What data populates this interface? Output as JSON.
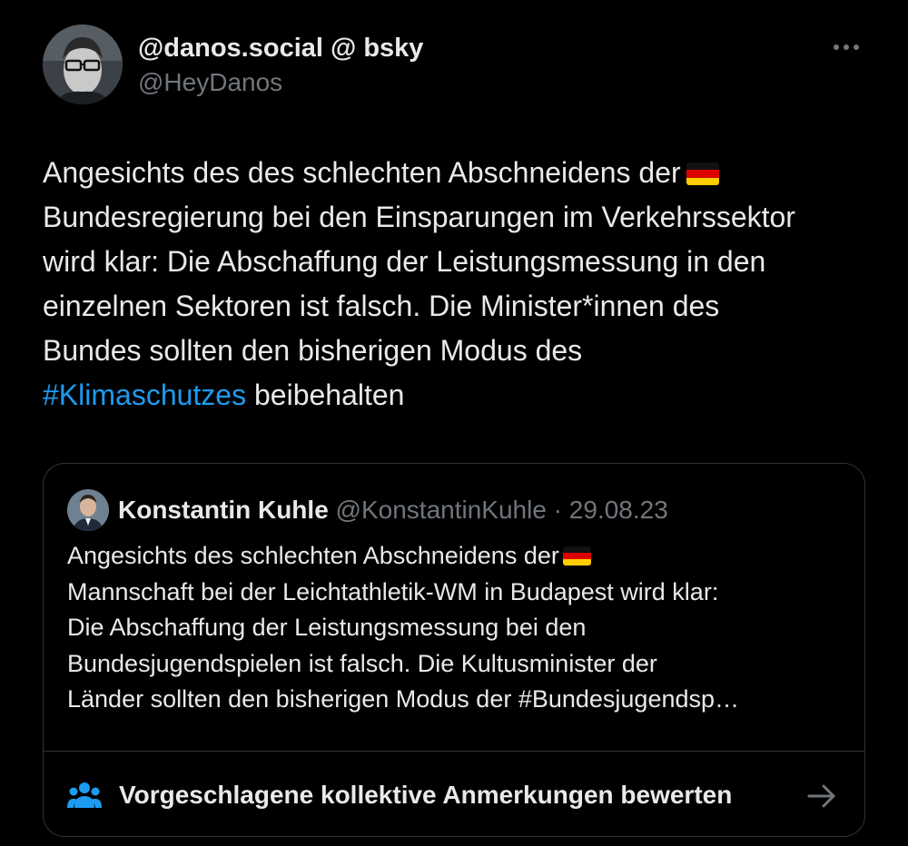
{
  "tweet": {
    "author": {
      "display_name": "@danos.social @ bsky",
      "handle": "@HeyDanos"
    },
    "more_icon": "more-horizontal-icon",
    "body": {
      "line1": "Angesichts des des schlechten Abschneidens der",
      "line2": "Bundesregierung bei den Einsparungen im Verkehrssektor",
      "line3": "wird klar: Die Abschaffung der Leistungsmessung in den",
      "line4": "einzelnen Sektoren ist falsch. Die Minister*innen des",
      "line5": "Bundes sollten den bisherigen Modus des",
      "hashtag": "#Klimaschutzes",
      "line6_rest": " beibehalten",
      "flag_emoji": "germany-flag-icon"
    },
    "quote": {
      "author": {
        "display_name": "Konstantin Kuhle",
        "handle": "@KonstantinKuhle",
        "separator": " · ",
        "date": "29.08.23"
      },
      "text": {
        "line1": "Angesichts des schlechten Abschneidens der",
        "line2": "Mannschaft bei der Leichtathletik-WM in Budapest wird klar:",
        "line3": "Die Abschaffung der Leistungsmessung bei den",
        "line4": "Bundesjugendspielen ist falsch. Die Kultusminister der",
        "line5": "Länder sollten den bisherigen Modus der #Bundesjugendsp…"
      }
    },
    "community_notes": {
      "label": "Vorgeschlagene kollektive Anmerkungen bewerten",
      "icon": "people-icon",
      "action_icon": "arrow-right-icon"
    }
  },
  "colors": {
    "background": "#000000",
    "text": "#e7e9ea",
    "secondary_text": "#71767b",
    "link": "#1d9bf0",
    "border": "#2f3336"
  }
}
